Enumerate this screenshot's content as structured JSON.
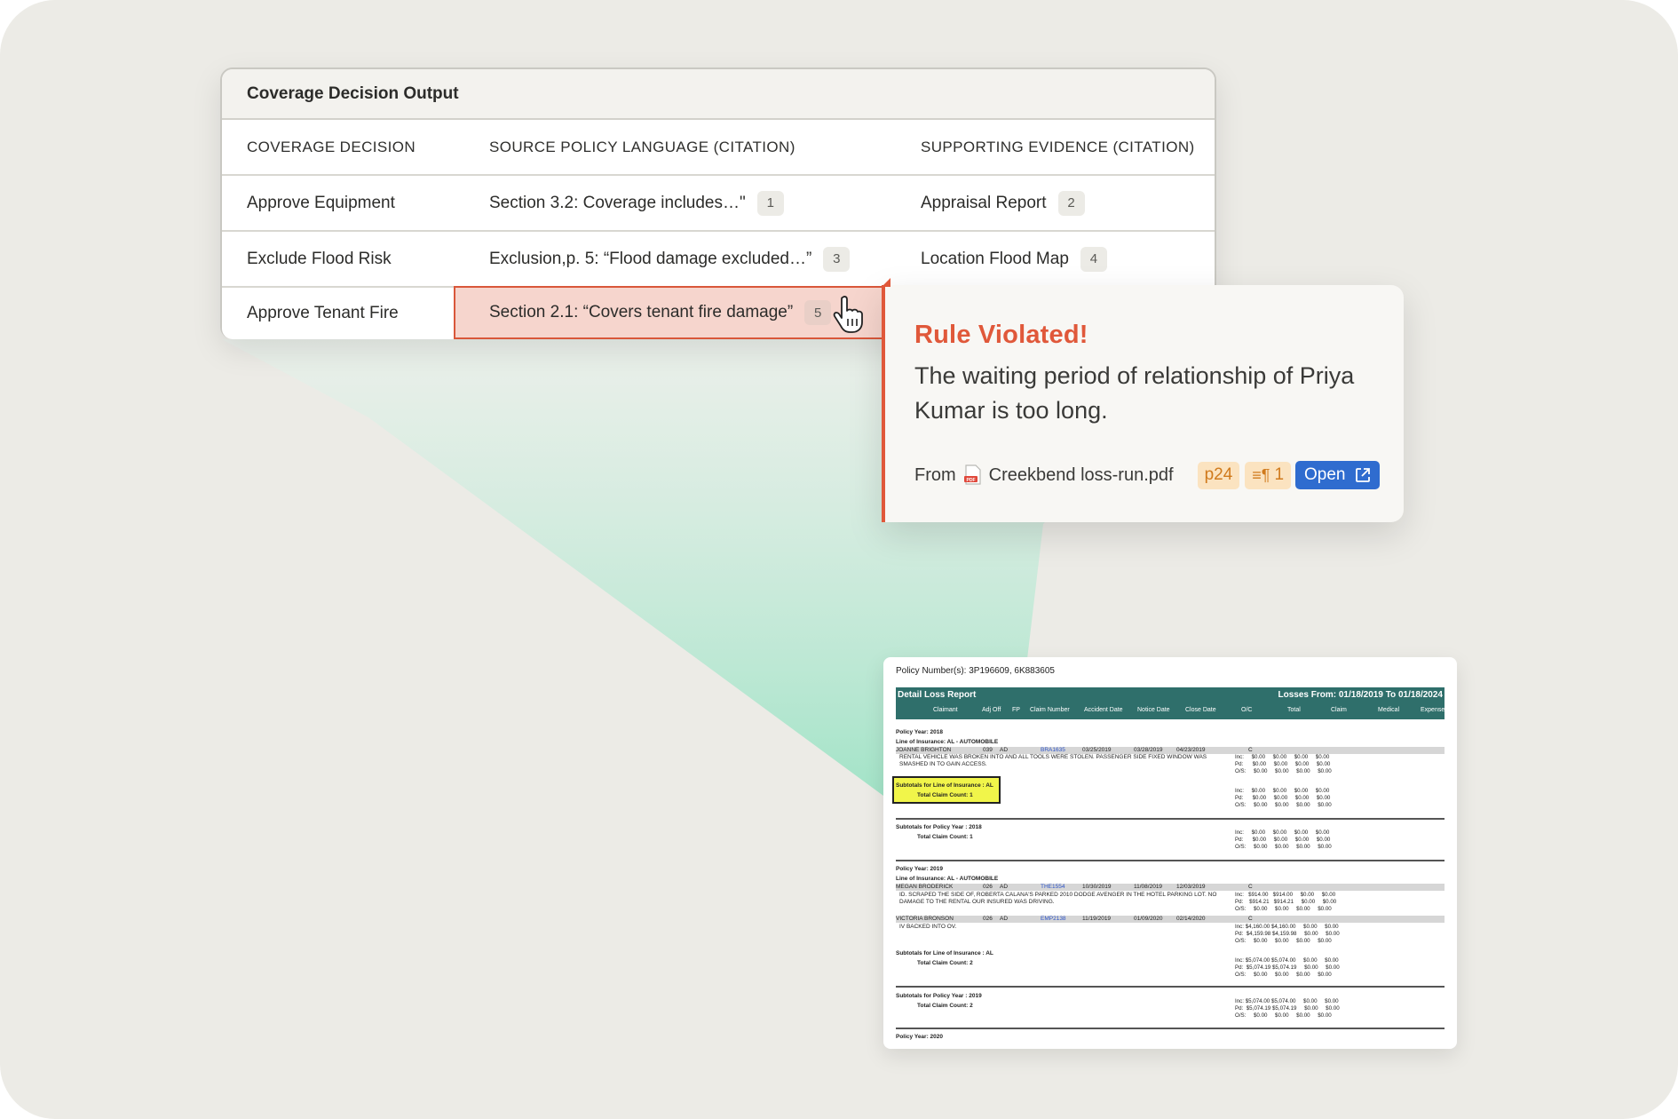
{
  "table": {
    "title": "Coverage Decision Output",
    "headers": [
      "COVERAGE DECISION",
      "SOURCE POLICY LANGUAGE (CITATION)",
      "SUPPORTING EVIDENCE (CITATION)"
    ],
    "rows": [
      {
        "decision": "Approve Equipment",
        "source": "Section 3.2: Coverage includes…\"",
        "source_cite": "1",
        "evidence": "Appraisal Report",
        "evidence_cite": "2"
      },
      {
        "decision": "Exclude Flood Risk",
        "source": "Exclusion,p. 5: “Flood damage excluded…”",
        "source_cite": "3",
        "evidence": "Location Flood Map",
        "evidence_cite": "4"
      },
      {
        "decision": "Approve Tenant Fire",
        "source": "Section 2.1: “Covers tenant fire damage”",
        "source_cite": "5"
      }
    ]
  },
  "popup": {
    "headline": "Rule Violated!",
    "message": "The waiting period of relationship  of Priya Kumar is too long.",
    "from_label": "From",
    "file_name": "Creekbend loss-run.pdf",
    "page_tag": "p24",
    "para_tag": "1",
    "open_label": "Open",
    "accent_color": "#e0583a",
    "button_color": "#2f6ccf"
  },
  "doc": {
    "policy_numbers": "Policy Number(s): 3P196609, 6K883605",
    "report_title": "Detail Loss Report",
    "losses_range": "Losses From: 01/18/2019 To 01/18/2024",
    "columns": [
      "Claimant",
      "Adj Off",
      "FP",
      "Claim Number",
      "Accident Date",
      "Notice Date",
      "Close Date",
      "O/C",
      "Total",
      "Claim",
      "Medical",
      "Expense"
    ],
    "py2018": "Policy Year: 2018",
    "loi_auto": "Line of Insurance: AL - AUTOMOBILE",
    "claim1": {
      "claimant": "JOANNE   BRIGHTON",
      "adj": "039",
      "fp": "AD",
      "number": "BRA1635",
      "acc": "03/25/2019",
      "notice": "03/28/2019",
      "close": "04/23/2019",
      "oc": "C",
      "desc": "RENTAL VEHICLE WAS BROKEN INTO AND ALL TOOLS WERE STOLEN. PASSENGER SIDE   FIXED WINDOW WAS SMASHED IN TO GAIN ACCESS."
    },
    "subtotal_loi": "Subtotals for Line of Insurance : AL",
    "count1": "Total Claim Count: 1",
    "subtotal_py2018": "Subtotals for Policy Year : 2018",
    "py2019": "Policy Year: 2019",
    "claim2": {
      "claimant": "MEGAN   BRODERICK",
      "adj": "026",
      "fp": "AD",
      "number": "THE1554",
      "acc": "10/30/2019",
      "notice": "11/08/2019",
      "close": "12/03/2019",
      "oc": "C",
      "desc1": "ID. SCRAPED THE SIDE OF, ROBERTA CALANA'S PARKED 2010 DODGE AVENGER IN THE HOTEL PARKING LOT. NO",
      "desc2": "DAMAGE TO THE RENTAL OUR INSURED WAS DRIVING."
    },
    "claim3": {
      "claimant": "VICTORIA   BRONSON",
      "adj": "026",
      "fp": "AD",
      "number": "EMP2138",
      "acc": "11/19/2019",
      "notice": "01/09/2020",
      "close": "02/14/2020",
      "oc": "C",
      "desc": "IV BACKED INTO OV."
    },
    "count2": "Total Claim Count: 2",
    "subtotal_py2019": "Subtotals for Policy Year : 2019",
    "py2020": "Policy Year: 2020",
    "zero_block": "Inc:     $0.00     $0.00     $0.00     $0.00\nPd:      $0.00     $0.00     $0.00     $0.00\nO/S:     $0.00     $0.00     $0.00     $0.00",
    "claim2_block": "Inc:   $914.00   $914.00     $0.00     $0.00\nPd:    $914.21   $914.21     $0.00     $0.00\nO/S:     $0.00     $0.00     $0.00     $0.00",
    "claim3_block": "Inc: $4,160.00 $4,160.00     $0.00     $0.00\nPd:  $4,159.98 $4,159.98     $0.00     $0.00\nO/S:     $0.00     $0.00     $0.00     $0.00",
    "sum_block": "Inc: $5,074.00 $5,074.00     $0.00     $0.00\nPd:  $5,074.19 $5,074.19     $0.00     $0.00\nO/S:     $0.00     $0.00     $0.00     $0.00"
  }
}
